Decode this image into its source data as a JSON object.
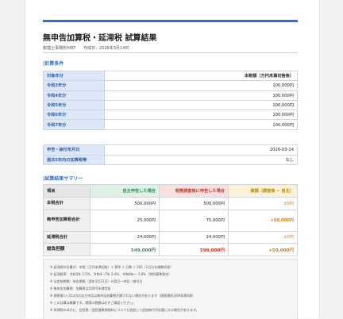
{
  "doc": {
    "title": "無申告加算税・延滞税 試算結果",
    "preparer": "税理士事務所HIRT",
    "created": "作成日：2026年3月14日"
  },
  "calc_conditions": {
    "section_title": "計算条件",
    "header_label": "対象年分",
    "header_value": "本税額（万円未満切捨後）",
    "rows": [
      {
        "label": "令和3年分",
        "value": "100,000円"
      },
      {
        "label": "令和4年分",
        "value": "100,000円"
      },
      {
        "label": "令和5年分",
        "value": "100,000円"
      },
      {
        "label": "令和6年分",
        "value": "100,000円"
      },
      {
        "label": "令和7年分",
        "value": "100,000円"
      }
    ],
    "extra": [
      {
        "label": "申告・納付年月日",
        "value": "2026-03-14"
      },
      {
        "label": "過去5年内の加算税等",
        "value": "なし"
      }
    ]
  },
  "summary": {
    "section_title": "試算結果サマリー",
    "headers": [
      "項目",
      "自主申告した場合",
      "税務調査後に申告した場合",
      "差額（調査後 − 自主）"
    ],
    "rows": [
      {
        "label": "本税合計",
        "self": "500,000円",
        "audit": "500,000円",
        "diff": "±0円"
      },
      {
        "label": "無申告加算税合計",
        "self": "25,000円",
        "audit": "75,000円",
        "diff": "+50,000円"
      },
      {
        "label": "延滞税合計",
        "self": "24,000円",
        "audit": "24,000円",
        "diff": "±0円"
      }
    ],
    "total": {
      "label": "総負担額",
      "self": "549,000円",
      "audit": "599,000円",
      "diff": "+50,000円"
    }
  },
  "notes": [
    "※ 延滞税の計算式：本税（万円未満切捨）× 税率 × 日数 ÷ 365（1日分を端数切捨）",
    "※ 延滞税率：令和3年 2.5%、令和4〜7年 2.4%、令和8年〜 2.8%（特例基準割合）",
    "※ 法定納期限：申告期限（翌年3月15日）の翌日〜申告・納付日",
    "※ 無申告加算税：加算税は100円未満切捨",
    "※ 期限後1ヶ月以内の自主申告は無申告加算税が課されない場合があります（国税通則法66条第6項）",
    "※ この計算は概算です。実際の税額は必ずご確認ください。",
    "※ 所得税のほかに、住民税・国民健康保険料についても追加して追加納付が必要になる場合があります。"
  ]
}
